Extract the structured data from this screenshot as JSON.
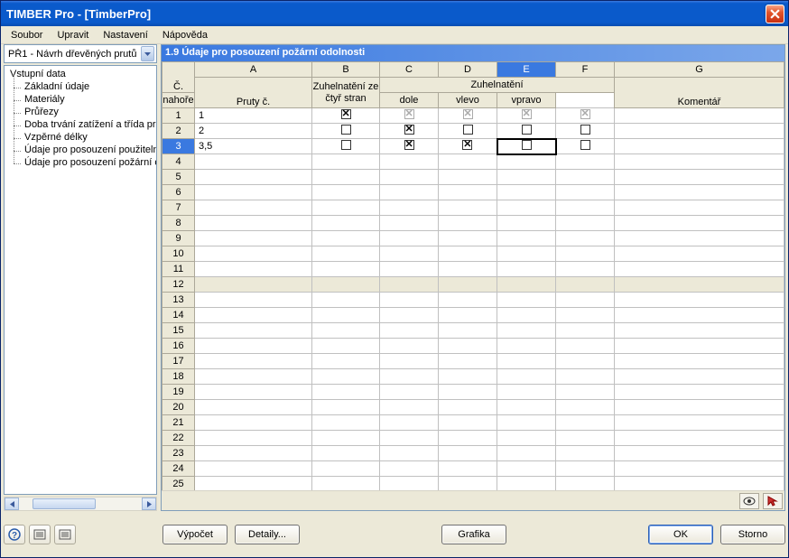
{
  "window": {
    "title": "TIMBER Pro - [TimberPro]"
  },
  "menu": {
    "items": [
      "Soubor",
      "Upravit",
      "Nastavení",
      "Nápověda"
    ]
  },
  "combo": {
    "selected": "PŘ1 - Návrh dřevěných prutů"
  },
  "tree": {
    "root": "Vstupní data",
    "items": [
      "Základní údaje",
      "Materiály",
      "Průřezy",
      "Doba trvání zatížení a třída provozu",
      "Vzpěrné délky",
      "Údaje pro posouzení použitelnosti",
      "Údaje pro posouzení požární odolnosti"
    ]
  },
  "pane": {
    "title": "1.9 Údaje pro posouzení požární odolnosti"
  },
  "grid": {
    "cornerLabel": "Č.",
    "colLetters": [
      "A",
      "B",
      "C",
      "D",
      "E",
      "F",
      "G"
    ],
    "colHeaders": {
      "A": "Pruty č.",
      "B": "Zuhelnatění ze čtyř stran",
      "group": "Zuhelnatění",
      "C": "nahoře",
      "D": "dole",
      "E": "vlevo",
      "F": "vpravo",
      "G": "Komentář"
    },
    "selectedCol": "E",
    "selectedRow": 3,
    "rowCount": 25,
    "rows": [
      {
        "n": 1,
        "A": "1",
        "B": {
          "checked": true,
          "disabled": false
        },
        "C": {
          "checked": true,
          "disabled": true
        },
        "D": {
          "checked": true,
          "disabled": true
        },
        "E": {
          "checked": true,
          "disabled": true
        },
        "F": {
          "checked": true,
          "disabled": true
        },
        "G": ""
      },
      {
        "n": 2,
        "A": "2",
        "B": {
          "checked": false,
          "disabled": false
        },
        "C": {
          "checked": true,
          "disabled": false
        },
        "D": {
          "checked": false,
          "disabled": false
        },
        "E": {
          "checked": false,
          "disabled": false
        },
        "F": {
          "checked": false,
          "disabled": false
        },
        "G": ""
      },
      {
        "n": 3,
        "A": "3,5",
        "B": {
          "checked": false,
          "disabled": false
        },
        "C": {
          "checked": true,
          "disabled": false
        },
        "D": {
          "checked": true,
          "disabled": false
        },
        "E": {
          "checked": false,
          "disabled": false
        },
        "F": {
          "checked": false,
          "disabled": false
        },
        "G": ""
      }
    ]
  },
  "buttons": {
    "vypocet": "Výpočet",
    "detaily": "Detaily...",
    "grafika": "Grafika",
    "ok": "OK",
    "storno": "Storno"
  },
  "icons": {
    "help": "help-icon",
    "picklist1": "picklist-icon",
    "picklist2": "picklist-icon",
    "eye": "eye-icon",
    "pointer": "pointer-icon"
  }
}
